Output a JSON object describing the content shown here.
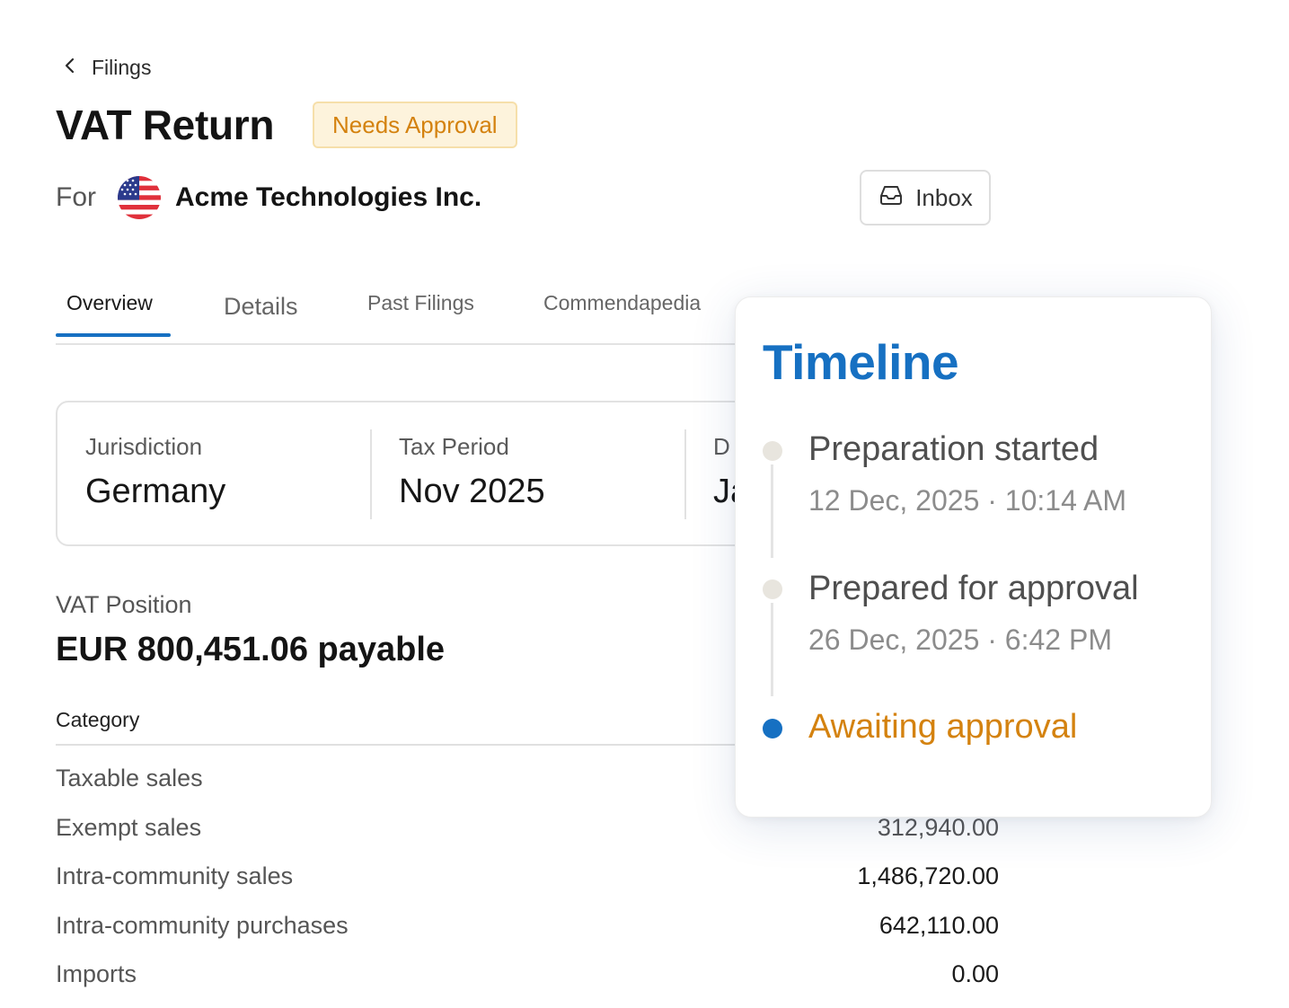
{
  "breadcrumb": {
    "label": "Filings"
  },
  "header": {
    "title": "VAT Return",
    "status": "Needs Approval",
    "for_label": "For",
    "company": "Acme Technologies Inc.",
    "inbox_label": "Inbox"
  },
  "tabs": [
    {
      "label": "Overview",
      "active": true
    },
    {
      "label": "Details"
    },
    {
      "label": "Past Filings"
    },
    {
      "label": "Commendapedia"
    }
  ],
  "info": [
    {
      "label": "Jurisdiction",
      "value": "Germany"
    },
    {
      "label": "Tax Period",
      "value": "Nov 2025"
    },
    {
      "label": "D",
      "value": "Ja"
    }
  ],
  "vat": {
    "label": "VAT Position",
    "amount": "EUR 800,451.06 payable"
  },
  "table": {
    "header": "Category",
    "rows": [
      {
        "label": "Taxable sales",
        "value": ""
      },
      {
        "label": "Exempt sales",
        "value": "312,940.00"
      },
      {
        "label": "Intra-community sales",
        "value": "1,486,720.00"
      },
      {
        "label": "Intra-community purchases",
        "value": "642,110.00"
      },
      {
        "label": "Imports",
        "value": "0.00"
      }
    ]
  },
  "timeline": {
    "title": "Timeline",
    "events": [
      {
        "title": "Preparation started",
        "time": "12 Dec, 2025 · 10:14 AM"
      },
      {
        "title": "Prepared for approval",
        "time": "26 Dec, 2025 · 6:42 PM"
      },
      {
        "title": "Awaiting approval",
        "current": true
      }
    ]
  },
  "colors": {
    "accent": "#1670c2",
    "status_orange": "#d4820f",
    "status_badge_bg": "#fdf3dc"
  },
  "icons": {
    "back": "chevron-left-icon",
    "flag": "us-flag-icon",
    "inbox": "inbox-tray-icon"
  }
}
